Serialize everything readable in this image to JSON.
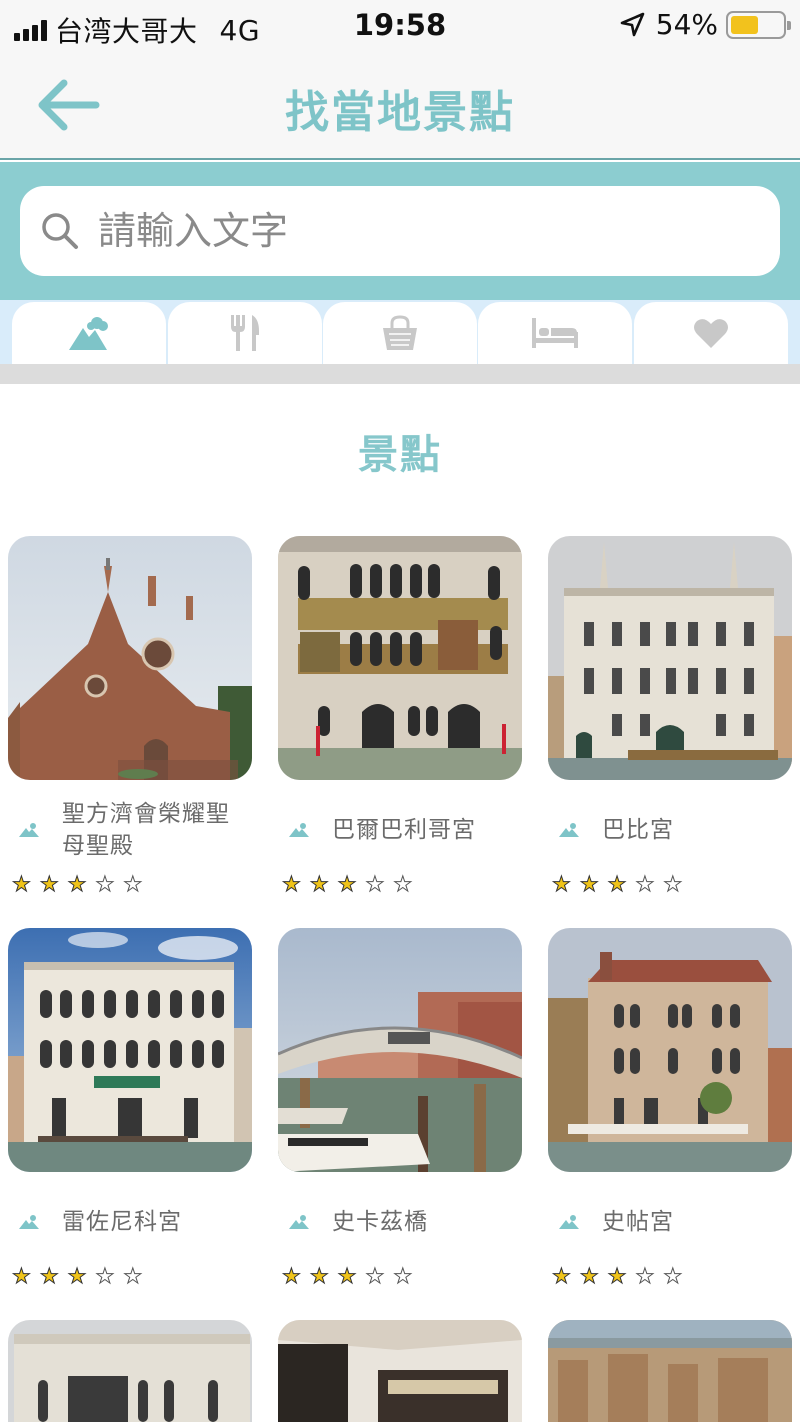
{
  "status_bar": {
    "carrier": "台湾大哥大",
    "network": "4G",
    "time": "19:58",
    "battery": "54%",
    "battery_level": 0.54
  },
  "header": {
    "title": "找當地景點",
    "back_icon": "arrow-left-icon"
  },
  "search": {
    "placeholder": "請輸入文字",
    "value": ""
  },
  "tabs": [
    {
      "icon": "mountain-cloud-icon",
      "active": true
    },
    {
      "icon": "fork-knife-icon",
      "active": false
    },
    {
      "icon": "shopping-bag-icon",
      "active": false
    },
    {
      "icon": "bed-icon",
      "active": false
    },
    {
      "icon": "heart-icon",
      "active": false
    }
  ],
  "section": {
    "title": "景點"
  },
  "attractions": [
    {
      "name": "聖方濟會榮耀聖母聖殿",
      "rating": 3
    },
    {
      "name": "巴爾巴利哥宮",
      "rating": 3
    },
    {
      "name": "巴比宮",
      "rating": 3
    },
    {
      "name": "雷佐尼科宮",
      "rating": 3
    },
    {
      "name": "史卡茲橋",
      "rating": 3
    },
    {
      "name": "史帖宮",
      "rating": 3
    }
  ],
  "rating_max": 5,
  "colors": {
    "accent": "#7ec4c8",
    "search_band": "#8ccdd0",
    "tab_band": "#d9ecfa",
    "star": "#f0c419"
  }
}
